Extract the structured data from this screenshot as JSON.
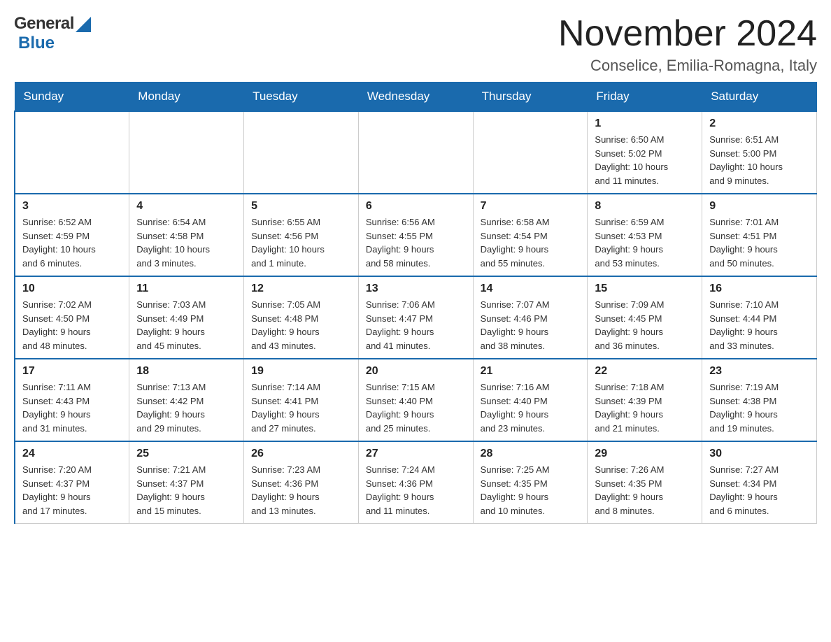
{
  "header": {
    "logo_general": "General",
    "logo_triangle": "▶",
    "logo_blue": "Blue",
    "month_title": "November 2024",
    "location": "Conselice, Emilia-Romagna, Italy"
  },
  "weekdays": [
    "Sunday",
    "Monday",
    "Tuesday",
    "Wednesday",
    "Thursday",
    "Friday",
    "Saturday"
  ],
  "weeks": [
    [
      {
        "day": "",
        "info": ""
      },
      {
        "day": "",
        "info": ""
      },
      {
        "day": "",
        "info": ""
      },
      {
        "day": "",
        "info": ""
      },
      {
        "day": "",
        "info": ""
      },
      {
        "day": "1",
        "info": "Sunrise: 6:50 AM\nSunset: 5:02 PM\nDaylight: 10 hours\nand 11 minutes."
      },
      {
        "day": "2",
        "info": "Sunrise: 6:51 AM\nSunset: 5:00 PM\nDaylight: 10 hours\nand 9 minutes."
      }
    ],
    [
      {
        "day": "3",
        "info": "Sunrise: 6:52 AM\nSunset: 4:59 PM\nDaylight: 10 hours\nand 6 minutes."
      },
      {
        "day": "4",
        "info": "Sunrise: 6:54 AM\nSunset: 4:58 PM\nDaylight: 10 hours\nand 3 minutes."
      },
      {
        "day": "5",
        "info": "Sunrise: 6:55 AM\nSunset: 4:56 PM\nDaylight: 10 hours\nand 1 minute."
      },
      {
        "day": "6",
        "info": "Sunrise: 6:56 AM\nSunset: 4:55 PM\nDaylight: 9 hours\nand 58 minutes."
      },
      {
        "day": "7",
        "info": "Sunrise: 6:58 AM\nSunset: 4:54 PM\nDaylight: 9 hours\nand 55 minutes."
      },
      {
        "day": "8",
        "info": "Sunrise: 6:59 AM\nSunset: 4:53 PM\nDaylight: 9 hours\nand 53 minutes."
      },
      {
        "day": "9",
        "info": "Sunrise: 7:01 AM\nSunset: 4:51 PM\nDaylight: 9 hours\nand 50 minutes."
      }
    ],
    [
      {
        "day": "10",
        "info": "Sunrise: 7:02 AM\nSunset: 4:50 PM\nDaylight: 9 hours\nand 48 minutes."
      },
      {
        "day": "11",
        "info": "Sunrise: 7:03 AM\nSunset: 4:49 PM\nDaylight: 9 hours\nand 45 minutes."
      },
      {
        "day": "12",
        "info": "Sunrise: 7:05 AM\nSunset: 4:48 PM\nDaylight: 9 hours\nand 43 minutes."
      },
      {
        "day": "13",
        "info": "Sunrise: 7:06 AM\nSunset: 4:47 PM\nDaylight: 9 hours\nand 41 minutes."
      },
      {
        "day": "14",
        "info": "Sunrise: 7:07 AM\nSunset: 4:46 PM\nDaylight: 9 hours\nand 38 minutes."
      },
      {
        "day": "15",
        "info": "Sunrise: 7:09 AM\nSunset: 4:45 PM\nDaylight: 9 hours\nand 36 minutes."
      },
      {
        "day": "16",
        "info": "Sunrise: 7:10 AM\nSunset: 4:44 PM\nDaylight: 9 hours\nand 33 minutes."
      }
    ],
    [
      {
        "day": "17",
        "info": "Sunrise: 7:11 AM\nSunset: 4:43 PM\nDaylight: 9 hours\nand 31 minutes."
      },
      {
        "day": "18",
        "info": "Sunrise: 7:13 AM\nSunset: 4:42 PM\nDaylight: 9 hours\nand 29 minutes."
      },
      {
        "day": "19",
        "info": "Sunrise: 7:14 AM\nSunset: 4:41 PM\nDaylight: 9 hours\nand 27 minutes."
      },
      {
        "day": "20",
        "info": "Sunrise: 7:15 AM\nSunset: 4:40 PM\nDaylight: 9 hours\nand 25 minutes."
      },
      {
        "day": "21",
        "info": "Sunrise: 7:16 AM\nSunset: 4:40 PM\nDaylight: 9 hours\nand 23 minutes."
      },
      {
        "day": "22",
        "info": "Sunrise: 7:18 AM\nSunset: 4:39 PM\nDaylight: 9 hours\nand 21 minutes."
      },
      {
        "day": "23",
        "info": "Sunrise: 7:19 AM\nSunset: 4:38 PM\nDaylight: 9 hours\nand 19 minutes."
      }
    ],
    [
      {
        "day": "24",
        "info": "Sunrise: 7:20 AM\nSunset: 4:37 PM\nDaylight: 9 hours\nand 17 minutes."
      },
      {
        "day": "25",
        "info": "Sunrise: 7:21 AM\nSunset: 4:37 PM\nDaylight: 9 hours\nand 15 minutes."
      },
      {
        "day": "26",
        "info": "Sunrise: 7:23 AM\nSunset: 4:36 PM\nDaylight: 9 hours\nand 13 minutes."
      },
      {
        "day": "27",
        "info": "Sunrise: 7:24 AM\nSunset: 4:36 PM\nDaylight: 9 hours\nand 11 minutes."
      },
      {
        "day": "28",
        "info": "Sunrise: 7:25 AM\nSunset: 4:35 PM\nDaylight: 9 hours\nand 10 minutes."
      },
      {
        "day": "29",
        "info": "Sunrise: 7:26 AM\nSunset: 4:35 PM\nDaylight: 9 hours\nand 8 minutes."
      },
      {
        "day": "30",
        "info": "Sunrise: 7:27 AM\nSunset: 4:34 PM\nDaylight: 9 hours\nand 6 minutes."
      }
    ]
  ]
}
